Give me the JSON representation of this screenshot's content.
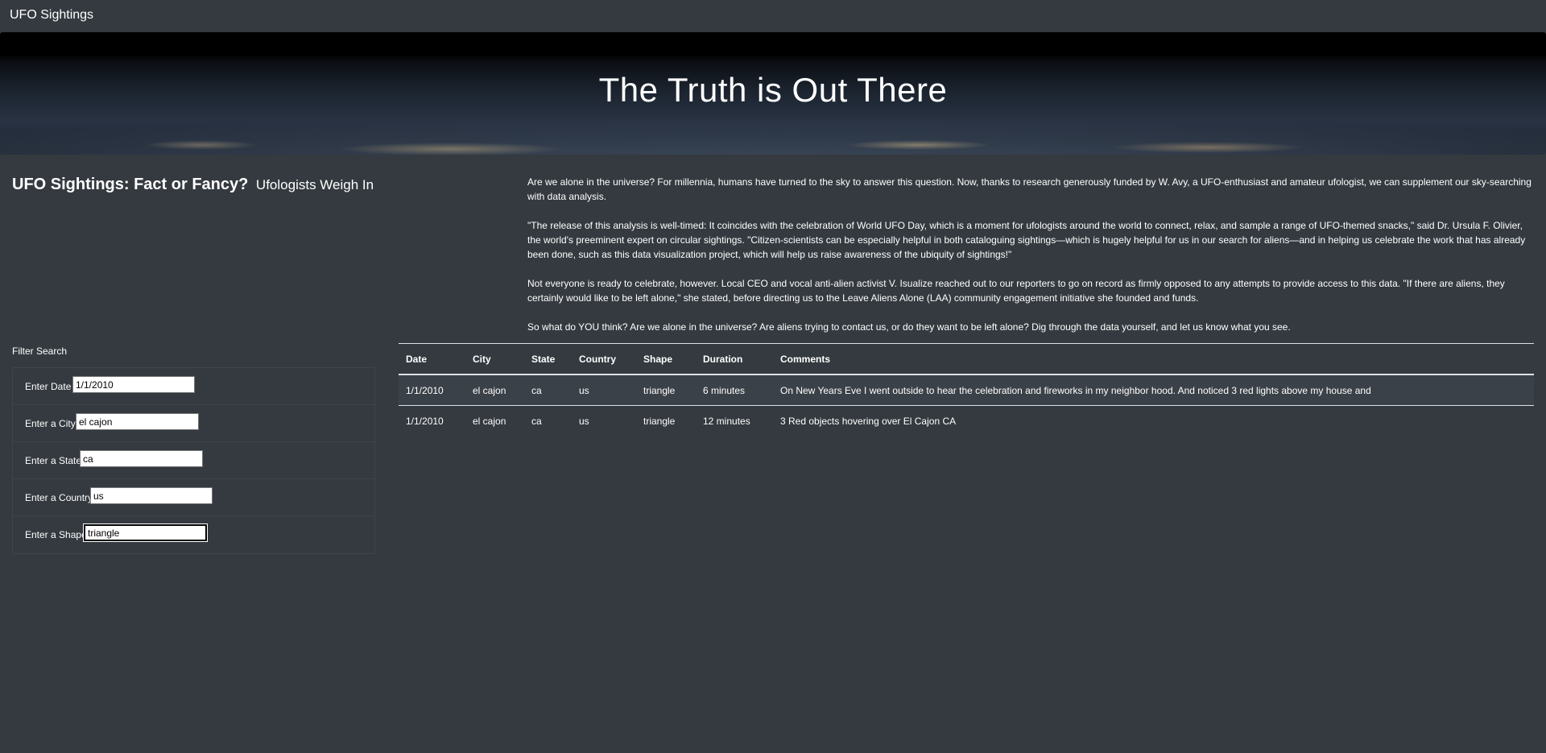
{
  "nav": {
    "brand": "UFO Sightings"
  },
  "hero": {
    "title": "The Truth is Out There"
  },
  "headline": {
    "title": "UFO Sightings: Fact or Fancy?",
    "subtitle": "Ufologists Weigh In"
  },
  "article": {
    "paragraphs": [
      "Are we alone in the universe? For millennia, humans have turned to the sky to answer this question. Now, thanks to research generously funded by W. Avy, a UFO-enthusiast and amateur ufologist, we can supplement our sky-searching with data analysis.",
      "\"The release of this analysis is well-timed: It coincides with the celebration of World UFO Day, which is a moment for ufologists around the world to connect, relax, and sample a range of UFO-themed snacks,\" said Dr. Ursula F. Olivier, the world's preeminent expert on circular sightings. \"Citizen-scientists can be especially helpful in both cataloguing sightings—which is hugely helpful for us in our search for aliens—and in helping us celebrate the work that has already been done, such as this data visualization project, which will help us raise awareness of the ubiquity of sightings!\"",
      "Not everyone is ready to celebrate, however. Local CEO and vocal anti-alien activist V. Isualize reached out to our reporters to go on record as firmly opposed to any attempts to provide access to this data. \"If there are aliens, they certainly would like to be left alone,\" she stated, before directing us to the Leave Aliens Alone (LAA) community engagement initiative she founded and funds.",
      "So what do YOU think? Are we alone in the universe? Are aliens trying to contact us, or do they want to be left alone? Dig through the data yourself, and let us know what you see."
    ]
  },
  "filters": {
    "title": "Filter Search",
    "fields": [
      {
        "label": "Enter Date",
        "value": "1/1/2010"
      },
      {
        "label": "Enter a City",
        "value": "el cajon"
      },
      {
        "label": "Enter a State",
        "value": "ca"
      },
      {
        "label": "Enter a Country",
        "value": "us"
      },
      {
        "label": "Enter a Shape",
        "value": "triangle"
      }
    ]
  },
  "table": {
    "headers": [
      "Date",
      "City",
      "State",
      "Country",
      "Shape",
      "Duration",
      "Comments"
    ],
    "rows": [
      [
        "1/1/2010",
        "el cajon",
        "ca",
        "us",
        "triangle",
        "6 minutes",
        "On New Years Eve I went outside to hear the celebration and fireworks in my neighbor hood. And noticed 3 red lights above my house and"
      ],
      [
        "1/1/2010",
        "el cajon",
        "ca",
        "us",
        "triangle",
        "12 minutes",
        "3 Red objects hovering over El Cajon CA"
      ]
    ]
  }
}
